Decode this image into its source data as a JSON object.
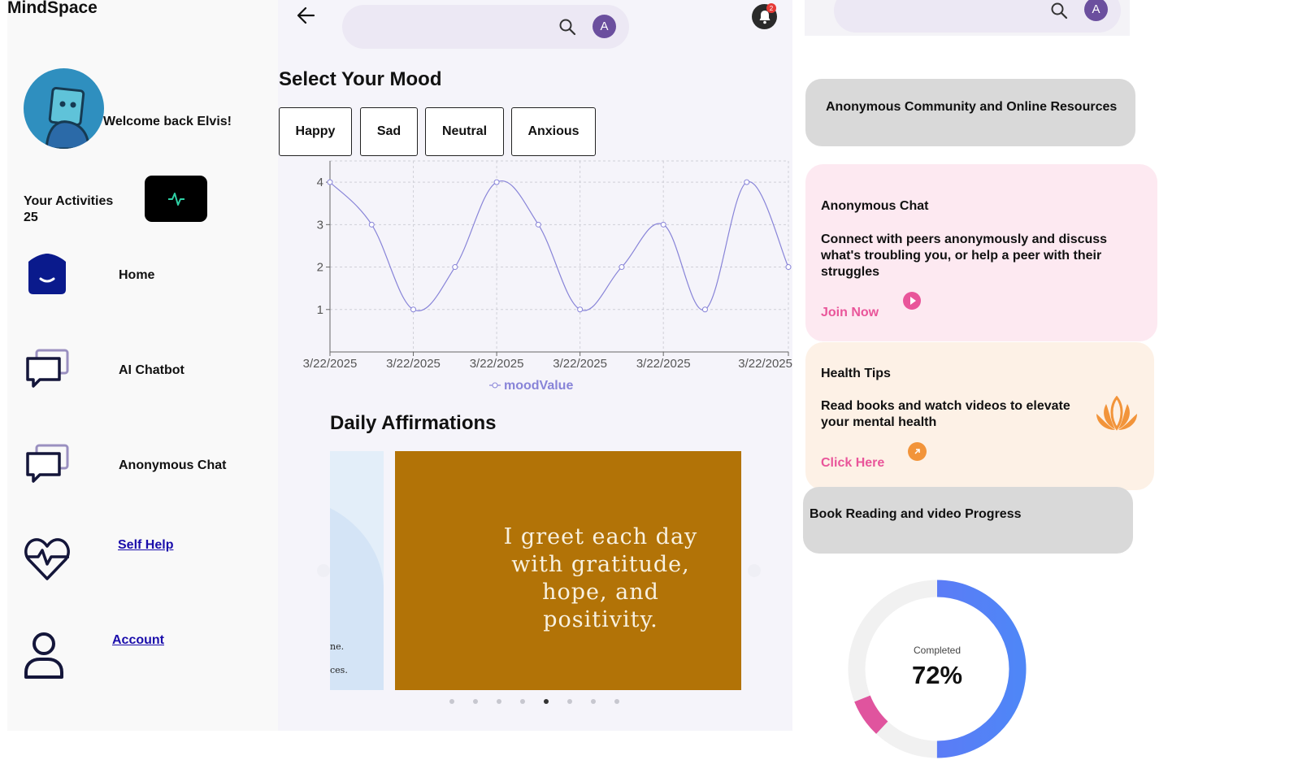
{
  "app": {
    "title": "MindSpace"
  },
  "sidebar": {
    "welcome": "Welcome back Elvis!",
    "activities_label": "Your Activities",
    "activities_count": "25",
    "items": [
      {
        "label": "Home"
      },
      {
        "label": "AI Chatbot"
      },
      {
        "label": "Anonymous Chat"
      },
      {
        "label": "Self Help"
      },
      {
        "label": "Account"
      }
    ]
  },
  "header": {
    "search_placeholder": "",
    "avatar_initial": "A",
    "notification_count": "2"
  },
  "mood": {
    "title": "Select Your Mood",
    "options": [
      "Happy",
      "Sad",
      "Neutral",
      "Anxious"
    ]
  },
  "chart_data": {
    "type": "line",
    "x": [
      "3/22/2025",
      "3/22/2025",
      "3/22/2025",
      "3/22/2025",
      "3/22/2025",
      "3/22/2025",
      "3/22/2025",
      "3/22/2025",
      "3/22/2025",
      "3/22/2025",
      "3/22/2025",
      "3/22/2025"
    ],
    "x_tick_labels": [
      "3/22/2025",
      "3/22/2025",
      "3/22/2025",
      "3/22/2025",
      "3/22/2025",
      "3/22/2025"
    ],
    "series": [
      {
        "name": "moodValue",
        "values": [
          4,
          3,
          1,
          2,
          4,
          3,
          1,
          2,
          3,
          1,
          4,
          2
        ]
      }
    ],
    "y_ticks": [
      1,
      2,
      3,
      4
    ],
    "ylim": [
      0,
      4.5
    ],
    "grid": true,
    "legend": "bottom",
    "color": "#8884d8"
  },
  "affirmations": {
    "title": "Daily Affirmations",
    "slide_text": "I greet each day with gratitude, hope, and positivity.",
    "partial_slide_lines": [
      "ne.",
      "ces."
    ],
    "dot_count": 8,
    "active_index": 4
  },
  "right": {
    "avatar_initial": "A",
    "community_title": "Anonymous Community and Online Resources",
    "chat_card": {
      "title": "Anonymous Chat",
      "text": "Connect with peers anonymously and discuss what's troubling you, or help a peer with their struggles",
      "link": "Join Now",
      "bg": "#fde9f1",
      "accent": "#e9559a"
    },
    "health_card": {
      "title": "Health Tips",
      "text": "Read books and watch videos to elevate your mental health",
      "link": "Click Here",
      "bg": "#fdf1e6",
      "link_color": "#e9559a",
      "accent": "#f2943a"
    },
    "progress_card": {
      "title": "Book Reading and video Progress",
      "completed_label": "Completed",
      "percent": "72%",
      "fraction": 0.72
    }
  }
}
